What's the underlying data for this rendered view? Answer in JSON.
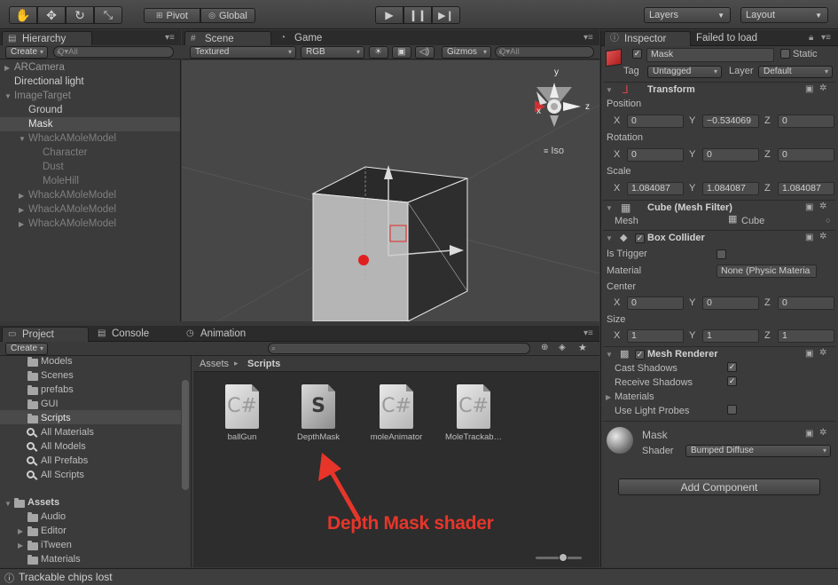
{
  "toolbar": {
    "pivot": "Pivot",
    "global": "Global",
    "layers": "Layers",
    "layout": "Layout"
  },
  "hierarchy": {
    "tab": "Hierarchy",
    "create": "Create",
    "search": "Q▾All",
    "items": [
      {
        "label": "ARCamera"
      },
      {
        "label": "Directional light"
      },
      {
        "label": "ImageTarget"
      },
      {
        "label": "Ground"
      },
      {
        "label": "Mask"
      },
      {
        "label": "WhackAMoleModel"
      },
      {
        "label": "Character"
      },
      {
        "label": "Dust"
      },
      {
        "label": "MoleHill"
      },
      {
        "label": "WhackAMoleModel"
      },
      {
        "label": "WhackAMoleModel"
      },
      {
        "label": "WhackAMoleModel"
      }
    ]
  },
  "scene": {
    "tab": "Scene",
    "game_tab": "Game",
    "textured": "Textured",
    "rgb": "RGB",
    "gizmos": "Gizmos",
    "search": "Q▾All",
    "iso": "Iso",
    "axis_y": "y",
    "axis_x": "x",
    "axis_z": "z"
  },
  "inspector": {
    "tab": "Inspector",
    "failed": "Failed to load",
    "name": "Mask",
    "static": "Static",
    "tag_label": "Tag",
    "tag_value": "Untagged",
    "layer_label": "Layer",
    "layer_value": "Default",
    "transform": {
      "title": "Transform",
      "position_label": "Position",
      "rotation_label": "Rotation",
      "scale_label": "Scale",
      "x_label": "X",
      "y_label": "Y",
      "z_label": "Z",
      "position": [
        "0",
        "−0.534069",
        "0"
      ],
      "rotation": [
        "0",
        "0",
        "0"
      ],
      "scale": [
        "1.084087",
        "1.084087",
        "1.084087"
      ]
    },
    "mesh_filter": {
      "title": "Cube (Mesh Filter)",
      "mesh_label": "Mesh",
      "mesh_value": "Cube"
    },
    "box_collider": {
      "title": "Box Collider",
      "is_trigger": "Is Trigger",
      "material_label": "Material",
      "material_value": "None (Physic Materia",
      "center_label": "Center",
      "size_label": "Size",
      "center": [
        "0",
        "0",
        "0"
      ],
      "size": [
        "1",
        "1",
        "1"
      ]
    },
    "mesh_renderer": {
      "title": "Mesh Renderer",
      "cast_shadows": "Cast Shadows",
      "receive_shadows": "Receive Shadows",
      "materials": "Materials",
      "light_probes": "Use Light Probes"
    },
    "material": {
      "name": "Mask",
      "shader_label": "Shader",
      "shader_value": "Bumped Diffuse"
    },
    "add_component": "Add Component"
  },
  "project": {
    "tab": "Project",
    "console_tab": "Console",
    "animation_tab": "Animation",
    "create": "Create",
    "tree": [
      {
        "label": "Models",
        "kind": "folder"
      },
      {
        "label": "Scenes",
        "kind": "folder"
      },
      {
        "label": "prefabs",
        "kind": "folder"
      },
      {
        "label": "GUI",
        "kind": "folder"
      },
      {
        "label": "Scripts",
        "kind": "folder"
      },
      {
        "label": "All Materials",
        "kind": "search"
      },
      {
        "label": "All Models",
        "kind": "search"
      },
      {
        "label": "All Prefabs",
        "kind": "search"
      },
      {
        "label": "All Scripts",
        "kind": "search"
      }
    ],
    "assets_root": "Assets",
    "assets_children": [
      "Audio",
      "Editor",
      "iTween",
      "Materials"
    ],
    "breadcrumb_root": "Assets",
    "breadcrumb_sep": "▸",
    "breadcrumb_current": "Scripts",
    "files": [
      {
        "name": "ballGun",
        "glyph": "C#"
      },
      {
        "name": "DepthMask",
        "glyph": "S"
      },
      {
        "name": "moleAnimator",
        "glyph": "C#"
      },
      {
        "name": "MoleTrackab…",
        "glyph": "C#"
      }
    ]
  },
  "annotation": "Depth Mask shader",
  "status": "Trackable chips lost",
  "colors": {
    "annotation_red": "#e8352a",
    "selection": "#4a4a4a"
  }
}
